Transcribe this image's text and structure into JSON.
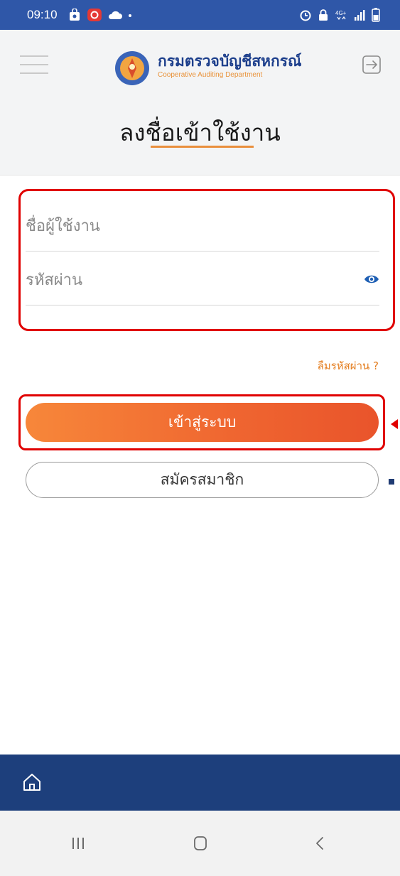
{
  "status_bar": {
    "time": "09:10",
    "icons_left": [
      "shopping-bag-icon",
      "app-notification-icon",
      "cloud-icon",
      "dot-icon"
    ],
    "icons_right": [
      "alarm-icon",
      "lock-icon",
      "4g-icon",
      "signal-icon",
      "battery-icon"
    ]
  },
  "header": {
    "department_name": "กรมตรวจบัญชีสหกรณ์",
    "department_subtitle": "Cooperative Auditing Department",
    "page_title": "ลงชื่อเข้าใช้งาน",
    "menu_icon": "hamburger-menu-icon",
    "logout_icon": "logout-icon"
  },
  "form": {
    "username_placeholder": "ชื่อผู้ใช้งาน",
    "password_placeholder": "รหัสผ่าน",
    "username_value": "",
    "password_value": "",
    "forgot_password": "ลืมรหัสผ่าน ?"
  },
  "buttons": {
    "login": "เข้าสู่ระบบ",
    "register": "สมัครสมาชิก"
  },
  "bottom_nav": {
    "home_icon": "home-icon"
  },
  "system_nav": {
    "recents_icon": "recent-apps-icon",
    "home_icon": "system-home-icon",
    "back_icon": "back-icon"
  },
  "colors": {
    "status_bar": "#2f57a8",
    "accent_orange": "#ef6530",
    "navy": "#1d3f7c",
    "highlight_red": "#e00000"
  }
}
